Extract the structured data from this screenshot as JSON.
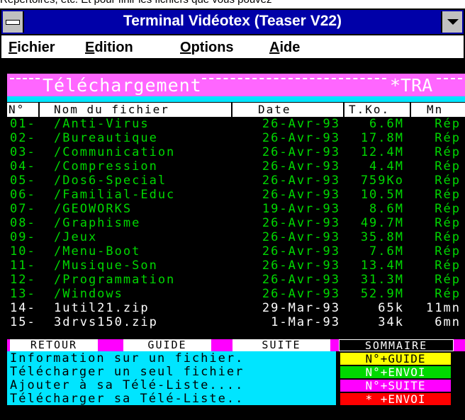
{
  "top_text": "Répertoires, etc. Et pour finir les fichiers que vous pouvez",
  "window": {
    "title": "Terminal Vidéotex (Teaser V22)"
  },
  "menu": [
    {
      "label": "Fichier",
      "accel": "F",
      "rest": "ichier"
    },
    {
      "label": "Edition",
      "accel": "E",
      "rest": "dition"
    },
    {
      "label": "Options",
      "accel": "O",
      "rest": "ptions"
    },
    {
      "label": "Aide",
      "accel": "A",
      "rest": "ide"
    }
  ],
  "banner": {
    "title": "Téléchargement",
    "right": "*TRA"
  },
  "table": {
    "headers": [
      "N°",
      "Nom du fichier",
      "Date",
      "T.Ko.",
      "Mn"
    ],
    "rows": [
      {
        "n": "01-",
        "name": "/Anti-Virus",
        "date": "26-Avr-93",
        "size": "6.6M",
        "mn": "Rép",
        "style": "green"
      },
      {
        "n": "02-",
        "name": "/Bureautique",
        "date": "26-Avr-93",
        "size": "17.8M",
        "mn": "Rép",
        "style": "green"
      },
      {
        "n": "03-",
        "name": "/Communication",
        "date": "26-Avr-93",
        "size": "12.4M",
        "mn": "Rép",
        "style": "green"
      },
      {
        "n": "04-",
        "name": "/Compression",
        "date": "26-Avr-93",
        "size": "4.4M",
        "mn": "Rép",
        "style": "green"
      },
      {
        "n": "05-",
        "name": "/Dos6-Special",
        "date": "26-Avr-93",
        "size": "759Ko",
        "mn": "Rép",
        "style": "green"
      },
      {
        "n": "06-",
        "name": "/Familial-Educ",
        "date": "26-Avr-93",
        "size": "10.5M",
        "mn": "Rép",
        "style": "green"
      },
      {
        "n": "07-",
        "name": "/GEOWORKS",
        "date": "19-Avr-93",
        "size": "8.6M",
        "mn": "Rép",
        "style": "green"
      },
      {
        "n": "08-",
        "name": "/Graphisme",
        "date": "26-Avr-93",
        "size": "49.7M",
        "mn": "Rép",
        "style": "green"
      },
      {
        "n": "09-",
        "name": "/Jeux",
        "date": "26-Avr-93",
        "size": "35.8M",
        "mn": "Rép",
        "style": "green"
      },
      {
        "n": "10-",
        "name": "/Menu-Boot",
        "date": "26-Avr-93",
        "size": "7.6M",
        "mn": "Rép",
        "style": "green"
      },
      {
        "n": "11-",
        "name": "/Musique-Son",
        "date": "26-Avr-93",
        "size": "13.4M",
        "mn": "Rép",
        "style": "green"
      },
      {
        "n": "12-",
        "name": "/Programmation",
        "date": "26-Avr-93",
        "size": "31.3M",
        "mn": "Rép",
        "style": "green"
      },
      {
        "n": "13-",
        "name": "/Windows",
        "date": "26-Avr-93",
        "size": "52.9M",
        "mn": "Rép",
        "style": "green"
      },
      {
        "n": "14-",
        "name": "1util21.zip",
        "date": "29-Mar-93",
        "size": "65k",
        "mn": "11mn",
        "style": "white"
      },
      {
        "n": "15-",
        "name": "3drvs150.zip",
        "date": "1-Mar-93",
        "size": "34k",
        "mn": "6mn",
        "style": "white"
      }
    ]
  },
  "commands": {
    "retour": "RETOUR",
    "guide": "GUIDE",
    "suite": "SUITE",
    "sommaire": "SOMMAIRE"
  },
  "info_lines": [
    "Information sur un fichier.",
    "Télécharger un seul fichier",
    "Ajouter à sa Télé-Liste....",
    "Télécharger sa Télé-Liste.."
  ],
  "keys": [
    {
      "label": "N°+GUIDE",
      "bg": "#ffff00",
      "fg": "#000000"
    },
    {
      "label": "N°+ENVOI",
      "bg": "#00d800",
      "fg": "#ffffff"
    },
    {
      "label": "N°+SUITE",
      "bg": "#ff00ff",
      "fg": "#ffffff"
    },
    {
      "label": "* +ENVOI",
      "bg": "#ff0000",
      "fg": "#ffffff"
    }
  ]
}
